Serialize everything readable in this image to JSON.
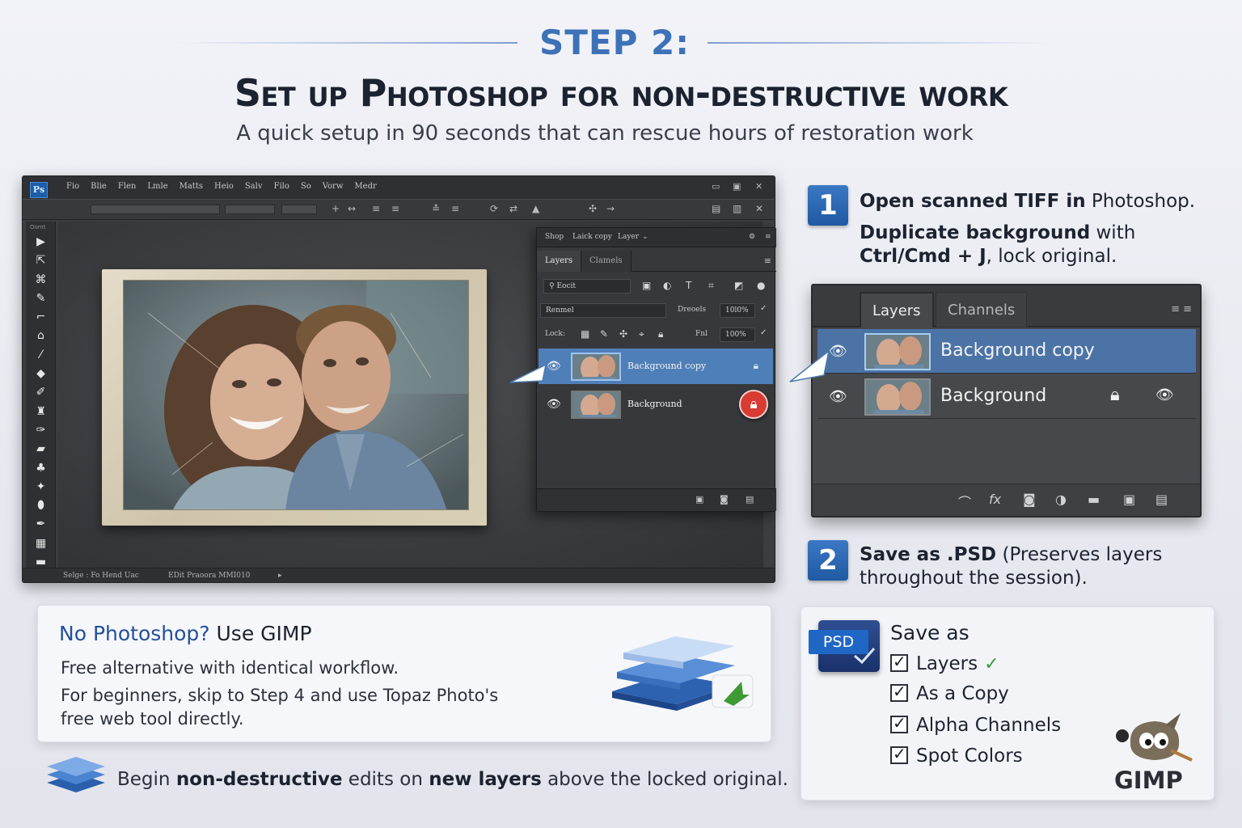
{
  "header": {
    "step": "STEP 2:",
    "title": "Set up Photoshop for non-destructive work",
    "subtitle": "A quick setup in 90 seconds that can rescue hours of restoration work"
  },
  "photoshop": {
    "logo": "Ps",
    "menus": [
      "Fio",
      "Blie",
      "Flen",
      "Lmle",
      "Matts",
      "Heio",
      "Salv",
      "Filo",
      "So",
      "Vorw",
      "Medr"
    ],
    "toolbar_header": "Oomt",
    "status_left": "Selge : Fo Hend Uac",
    "status_mid": "EDit Praoora MMI010",
    "panel": {
      "top_tabs": [
        "Shop",
        "Laick copy",
        "Layer"
      ],
      "tabs": [
        "Layers",
        "Clamels"
      ],
      "kind_filter": "Eocit",
      "blend_mode": "Renmel",
      "opacity_label": "Dreoels",
      "opacity_value": "10l0%",
      "lock_label": "Lock:",
      "fill_label": "Fnl",
      "fill_value": "100%",
      "layers": [
        "Background copy",
        "Background"
      ]
    }
  },
  "steps": {
    "one": {
      "number": "1",
      "line1_bold": "Open scanned TIFF in",
      "line1_rest": " Photoshop.",
      "line2_bold": "Duplicate background",
      "line2_rest": " with",
      "line3_bold": "Ctrl/Cmd + J",
      "line3_rest": ", lock original."
    },
    "two": {
      "number": "2",
      "bold": "Save as .PSD",
      "rest1": " (Preserves layers",
      "rest2": "throughout the session)."
    }
  },
  "layers_panel": {
    "tabs": [
      "Layers",
      "Channels"
    ],
    "layers": [
      "Background copy",
      "Background"
    ]
  },
  "gimp_card": {
    "title_blue": "No Photoshop?",
    "title_dark": " Use GIMP",
    "line1": "Free alternative with identical workflow.",
    "line2": "For beginners, skip to Step 4 and use Topaz Photo's",
    "line3": "free web tool directly."
  },
  "save_as": {
    "badge": "PSD",
    "title": "Save as",
    "options": [
      "Layers",
      "As a Copy",
      "Alpha Channels",
      "Spot Colors"
    ],
    "gimp": "GIMP"
  },
  "footer": {
    "part1": "Begin ",
    "bold1": "non-destructive",
    "part2": " edits on ",
    "bold2": "new layers",
    "part3": " above the locked original."
  },
  "colors": {
    "accent": "#3d72b8",
    "badge_blue": "#2a66b4",
    "selection": "#4b73a6",
    "lock_red": "#d83b32",
    "check_green": "#3a9b3c"
  }
}
